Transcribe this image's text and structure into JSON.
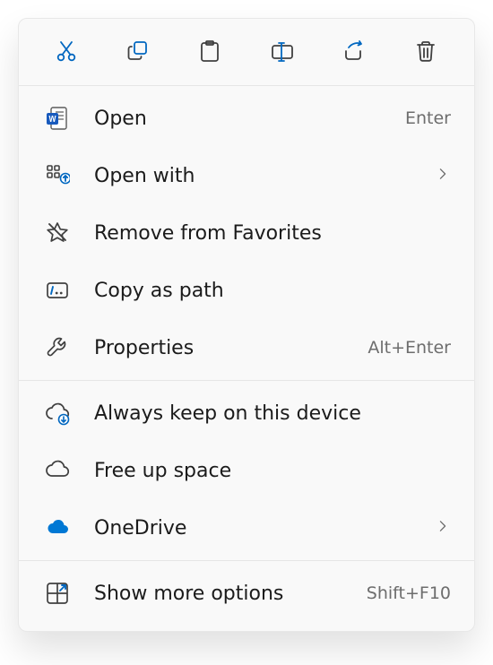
{
  "toolbar": [
    {
      "name": "cut",
      "active": true
    },
    {
      "name": "copy",
      "active": true
    },
    {
      "name": "paste",
      "active": false
    },
    {
      "name": "rename",
      "active": true
    },
    {
      "name": "share",
      "active": true
    },
    {
      "name": "delete",
      "active": false
    }
  ],
  "sections": [
    {
      "items": [
        {
          "icon": "word",
          "label": "Open",
          "accel": "Enter",
          "submenu": false
        },
        {
          "icon": "open-with",
          "label": "Open with",
          "accel": "",
          "submenu": true
        },
        {
          "icon": "star-remove",
          "label": "Remove from Favorites",
          "accel": "",
          "submenu": false
        },
        {
          "icon": "copy-path",
          "label": "Copy as path",
          "accel": "",
          "submenu": false
        },
        {
          "icon": "wrench",
          "label": "Properties",
          "accel": "Alt+Enter",
          "submenu": false
        }
      ]
    },
    {
      "items": [
        {
          "icon": "cloud-keep",
          "label": "Always keep on this device",
          "accel": "",
          "submenu": false
        },
        {
          "icon": "cloud",
          "label": "Free up space",
          "accel": "",
          "submenu": false
        },
        {
          "icon": "onedrive",
          "label": "OneDrive",
          "accel": "",
          "submenu": true
        }
      ]
    },
    {
      "items": [
        {
          "icon": "more",
          "label": "Show more options",
          "accel": "Shift+F10",
          "submenu": false
        }
      ]
    }
  ]
}
